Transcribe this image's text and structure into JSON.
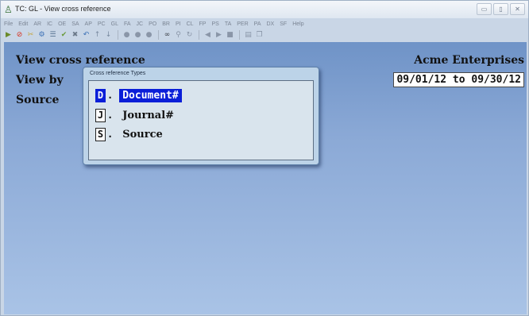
{
  "window": {
    "title": "TC: GL - View cross reference"
  },
  "menu": [
    "File",
    "Edit",
    "AR",
    "IC",
    "OE",
    "SA",
    "AP",
    "PC",
    "GL",
    "FA",
    "JC",
    "PO",
    "BR",
    "PI",
    "CL",
    "FP",
    "PS",
    "TA",
    "PER",
    "PA",
    "DX",
    "SF",
    "Help"
  ],
  "screen": {
    "heading": "View cross reference",
    "view_by_label": "View by",
    "source_label": "Source",
    "company": "Acme Enterprises",
    "date_range": "09/01/12 to 09/30/12"
  },
  "popup": {
    "title": "Cross reference Types",
    "options": [
      {
        "key": "D",
        "label": "Document#",
        "selected": true
      },
      {
        "key": "J",
        "label": "Journal#",
        "selected": false
      },
      {
        "key": "S",
        "label": "Source",
        "selected": false
      }
    ]
  },
  "toolbar_icons": [
    "go-icon",
    "stop-icon",
    "tools-icon",
    "settings-icon",
    "list-icon",
    "check-icon",
    "delete-icon",
    "undo-icon",
    "up-arrow-icon",
    "down-arrow-icon",
    "circle-1-icon",
    "circle-2-icon",
    "circle-3-icon",
    "binoculars-icon",
    "zoom-icon",
    "refresh-icon",
    "prev-icon",
    "next-icon",
    "record-icon",
    "calculator-icon",
    "copy-icon"
  ]
}
